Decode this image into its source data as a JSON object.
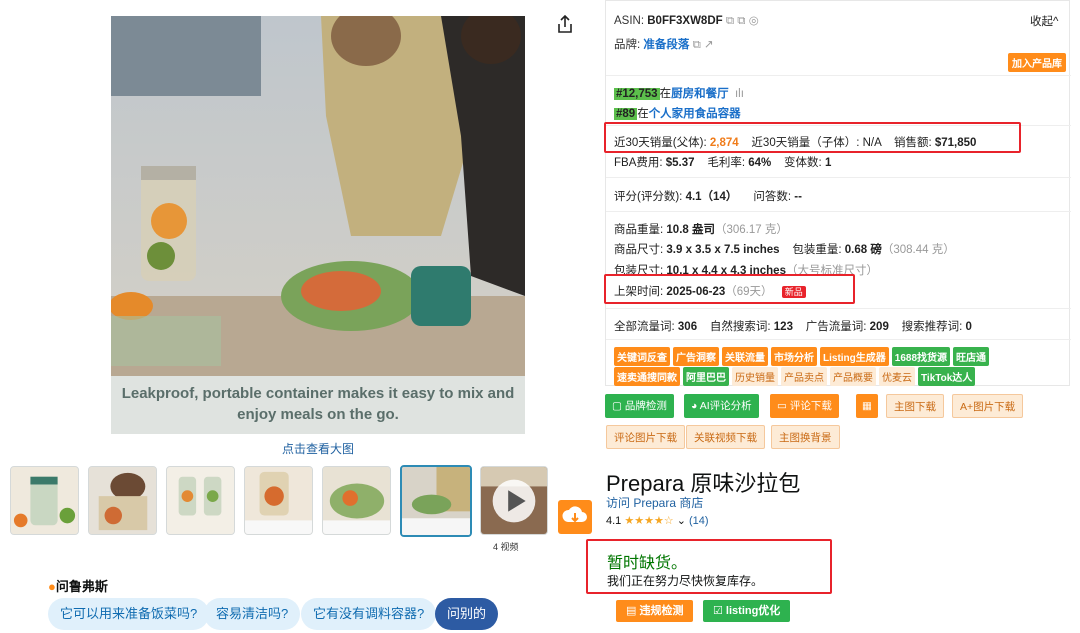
{
  "main_image": {
    "caption": "Leakproof, portable container makes it easy to mix and enjoy meals on the go.",
    "view_large": "点击查看大图"
  },
  "thumbnails": {
    "video_count": "4 视频"
  },
  "rufus": {
    "title": "问鲁弗斯",
    "chips": [
      "它可以用来准备饭菜吗?",
      "容易清洁吗?",
      "它有没有调料容器?"
    ],
    "ask": "问别的"
  },
  "panel": {
    "asin_label": "ASIN:",
    "asin": "B0FF3XW8DF",
    "collapse": "收起^",
    "brand_label": "品牌:",
    "brand": "准备段落",
    "add_library": "加入产品库",
    "rank1": "#12,753",
    "rank1_in": "在",
    "rank1_cat": "厨房和餐厅",
    "rank2": "#89",
    "rank2_in": "在",
    "rank2_cat": "个人家用食品容器",
    "sales_parent_label": "近30天销量(父体):",
    "sales_parent": "2,874",
    "sales_child_label": "近30天销量（子体）:",
    "sales_child": "N/A",
    "revenue_label": "销售额:",
    "revenue": "$71,850",
    "fba_label": "FBA费用:",
    "fba": "$5.37",
    "margin_label": "毛利率:",
    "margin": "64%",
    "variants_label": "变体数:",
    "variants": "1",
    "rating_label": "评分(评分数):",
    "rating": "4.1（14）",
    "qa_label": "问答数:",
    "qa": "--",
    "weight_label": "商品重量:",
    "weight": "10.8 盎司",
    "weight_g": "（306.17 克）",
    "size_label": "商品尺寸:",
    "size": "3.9 x 3.5 x 7.5 inches",
    "pkg_weight_label": "包装重量:",
    "pkg_weight": "0.68 磅",
    "pkg_weight_g": "（308.44 克）",
    "pkg_size_label": "包装尺寸:",
    "pkg_size": "10.1 x 4.4 x 4.3 inches",
    "pkg_size_note": "（大号标准尺寸）",
    "listed_label": "上架时间:",
    "listed": "2025-06-23",
    "listed_days": "（69天）",
    "new_badge": "新品",
    "kw_total_label": "全部流量词:",
    "kw_total": "306",
    "kw_organic_label": "自然搜索词:",
    "kw_organic": "123",
    "kw_ad_label": "广告流量词:",
    "kw_ad": "209",
    "kw_rec_label": "搜索推荐词:",
    "kw_rec": "0",
    "tags_row1": [
      {
        "t": "关键词反查",
        "c": "o"
      },
      {
        "t": "广告洞察",
        "c": "o"
      },
      {
        "t": "关联流量",
        "c": "o"
      },
      {
        "t": "市场分析",
        "c": "o"
      },
      {
        "t": "Listing生成器",
        "c": "o"
      },
      {
        "t": "1688找货源",
        "c": "g"
      },
      {
        "t": "旺店通",
        "c": "g"
      }
    ],
    "tags_row2": [
      {
        "t": "速卖通搜同款",
        "c": "o"
      },
      {
        "t": "阿里巴巴",
        "c": "g"
      },
      {
        "t": "历史销量",
        "c": "b"
      },
      {
        "t": "产品卖点",
        "c": "b"
      },
      {
        "t": "产品概要",
        "c": "b"
      },
      {
        "t": "优麦云",
        "c": "b"
      },
      {
        "t": "TikTok达人",
        "c": "g"
      }
    ]
  },
  "actions": {
    "brand_check": "品牌检测",
    "ai_review": "AI评论分析",
    "review_download": "评论下载",
    "main_download": "主图下载",
    "aplus_download": "A+图片下载",
    "review_img_download": "评论图片下载",
    "video_download": "关联视频下载",
    "main_bg": "主图换背景"
  },
  "product": {
    "title": "Prepara 原味沙拉包",
    "visit_store": "访问 Prepara 商店",
    "rating": "4.1",
    "stars": "★★★★☆",
    "reviews": "(14)",
    "oos": "暂时缺货。",
    "oos_sub": "我们正在努力尽快恢复库存。",
    "violation_check": "违规检测",
    "listing_opt": "listing优化"
  }
}
